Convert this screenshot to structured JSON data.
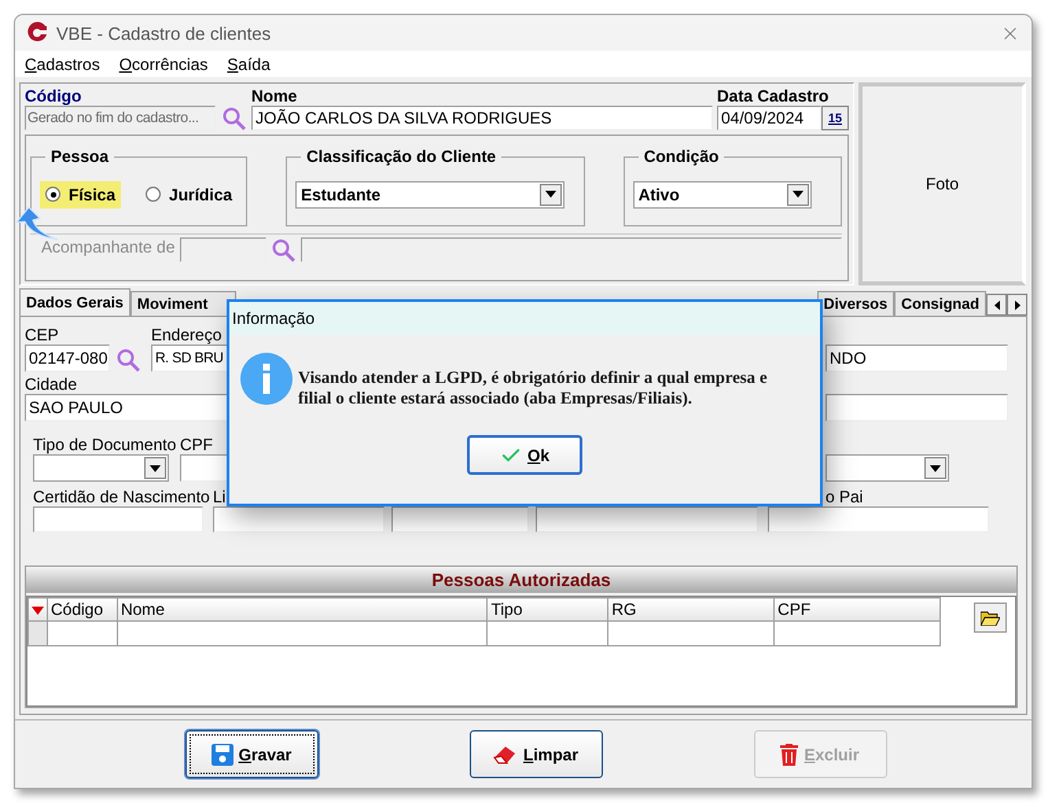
{
  "window": {
    "title": "VBE - Cadastro de clientes"
  },
  "menu": [
    {
      "label": "Cadastros"
    },
    {
      "label": "Ocorrências"
    },
    {
      "label": "Saída"
    }
  ],
  "header": {
    "code": {
      "label": "Código",
      "placeholder": "Gerado no fim do cadastro...",
      "disabled": true
    },
    "name": {
      "label": "Nome",
      "value": "JOÃO CARLOS DA SILVA RODRIGUES"
    },
    "date": {
      "label": "Data Cadastro",
      "value": "04/09/2024",
      "button": "15"
    }
  },
  "pessoa": {
    "title": "Pessoa",
    "options": [
      {
        "label": "Física",
        "selected": true,
        "highlighted": true
      },
      {
        "label": "Jurídica",
        "selected": false,
        "highlighted": false
      }
    ]
  },
  "classificacao": {
    "title": "Classificação do Cliente",
    "value": "Estudante"
  },
  "condicao": {
    "title": "Condição",
    "value": "Ativo"
  },
  "companion": {
    "label": "Acompanhante de",
    "disabled": true
  },
  "photo": {
    "label": "Foto"
  },
  "tabs": [
    {
      "label": "Dados Gerais",
      "selected": true
    },
    {
      "label": "Moviment",
      "selected": false
    },
    {
      "label": "Diversos",
      "selected": false
    },
    {
      "label": "Consignad",
      "selected": false
    }
  ],
  "form": {
    "cep": {
      "label": "CEP",
      "value": "02147-080"
    },
    "address": {
      "label": "Endereço",
      "value": "R. SD BRU"
    },
    "field_right_1": {
      "value": "NDO"
    },
    "city": {
      "label": "Cidade",
      "value": "SAO PAULO"
    },
    "doc_type": {
      "label": "Tipo de Documento"
    },
    "cpf": {
      "label": "CPF"
    },
    "birth_cert": {
      "label": "Certidão de Nascimento"
    },
    "field_li": {
      "label": "Li"
    },
    "father": {
      "label": "o Pai"
    }
  },
  "authorized": {
    "title": "Pessoas Autorizadas",
    "columns": [
      "Código",
      "Nome",
      "Tipo",
      "RG",
      "CPF"
    ]
  },
  "buttons": [
    {
      "label": "Gravar",
      "kind": "save",
      "disabled": false,
      "focused": true
    },
    {
      "label": "Limpar",
      "kind": "clear",
      "disabled": false,
      "focused": false
    },
    {
      "label": "Excluir",
      "kind": "delete",
      "disabled": true,
      "focused": false
    }
  ],
  "dialog": {
    "title": "Informação",
    "message_lines": [
      "Visando atender a LGPD, é obrigatório definir a qual empresa e",
      "filial o cliente estará associado (aba Empresas/Filiais)."
    ],
    "button": "Ok"
  }
}
